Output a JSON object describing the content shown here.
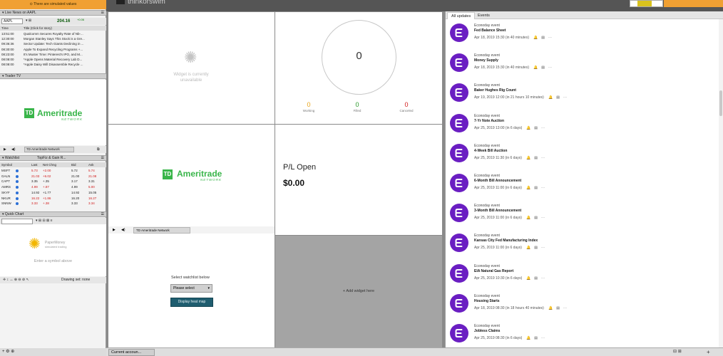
{
  "banner": {
    "text": "There are simulated values"
  },
  "live_news": {
    "header": "Live News on AAPL",
    "symbol": "AAPL",
    "price": "204.16",
    "change": "+0.06",
    "columns": {
      "time": "Time",
      "title": "Title (Click for story)"
    },
    "rows": [
      {
        "time": "13:51:00",
        "title": "Qualcomm Secures Royalty Rate of Nb-..."
      },
      {
        "time": "12:30:00",
        "title": "Morgan Stanley Says This Stock is a Gre..."
      },
      {
        "time": "09:36:36",
        "title": "Sector Update: Tech Giants Declining in ..."
      },
      {
        "time": "08:30:00",
        "title": "Apple To Expand Recycling Programs +..."
      },
      {
        "time": "08:23:00",
        "title": "It's Muster Time: Pinterest's IPO, and M..."
      },
      {
        "time": "08:08:00",
        "title": "*Apple Opens Material Recovery Lab D..."
      },
      {
        "time": "08:08:00",
        "title": "*Apple Daisy Will Disassemble Recycle ..."
      }
    ]
  },
  "trader_tv": {
    "header": "Trader TV",
    "logo_brand": "Ameritrade",
    "logo_sub": "NETWORK",
    "logo_mark": "TD",
    "tab_label": "TD Ameritrade Network"
  },
  "watchlist": {
    "header": "Watchlist",
    "tab": "TopFiz & Gain R...",
    "columns": [
      "Symbol",
      "Last",
      "Net Chng",
      "Bid",
      "Ask"
    ],
    "rows": [
      {
        "symbol": "MSFT",
        "last": "5.73",
        "net": "+2.00",
        "bid": "5.72",
        "ask": "5.74",
        "color": "#d11a1a"
      },
      {
        "symbol": "GALN",
        "last": "21.03",
        "net": "+6.02",
        "bid": "21.00",
        "ask": "21.08",
        "color": "#d11a1a"
      },
      {
        "symbol": "CAPT",
        "last": "3.35",
        "net": "+.35",
        "bid": "3.17",
        "ask": "3.31",
        "color": "#222222"
      },
      {
        "symbol": "AMRS",
        "last": "4.99",
        "net": "+.87",
        "bid": "4.99",
        "ask": "5.00",
        "color": "#d11a1a"
      },
      {
        "symbol": "SKYF",
        "last": "14.92",
        "net": "+1.77",
        "bid": "14.92",
        "ask": "15.05",
        "color": "#222222"
      },
      {
        "symbol": "NKUR",
        "last": "16.22",
        "net": "+1.86",
        "bid": "16.20",
        "ask": "16.27",
        "color": "#d11a1a"
      },
      {
        "symbol": "SNNW",
        "last": "3.33",
        "net": "+.38",
        "bid": "3.33",
        "ask": "3.34",
        "color": "#d11a1a"
      }
    ]
  },
  "quick_chart": {
    "header": "Quick Chart",
    "brand": "PaperMoney",
    "brand_sub": "simulated trading",
    "message": "Enter a symbol above",
    "drawing_label": "Drawing set: none"
  },
  "app": {
    "title": "thinkorswim",
    "bottom_tab": "Current accoun..."
  },
  "widget_unavailable": {
    "text": "Widget is currently unavailable"
  },
  "orders": {
    "count": "0",
    "working": {
      "value": "0",
      "label": "Working",
      "color": "#e8a317"
    },
    "filled": {
      "value": "0",
      "label": "Filled",
      "color": "#2c9a2c"
    },
    "canceled": {
      "value": "0",
      "label": "Canceled",
      "color": "#d11a1a"
    }
  },
  "ameritrade_widget": {
    "brand": "Ameritrade",
    "sub": "NETWORK",
    "mark": "TD"
  },
  "pl": {
    "label": "P/L Open",
    "value": "$0.00"
  },
  "tv2": {
    "tab_label": "TD Ameritrade Network"
  },
  "heatmap": {
    "label": "Select watchlist below",
    "select": "Please select",
    "button": "Display heat map"
  },
  "add_widget": {
    "label": "+ Add widget here"
  },
  "events_panel": {
    "tabs": [
      "All updates",
      "Events"
    ],
    "items": [
      {
        "type": "Econoday event",
        "name": "Fed Balance Sheet",
        "meta": "Apr 18, 2019 15:30 (in 40 minutes)"
      },
      {
        "type": "Econoday event",
        "name": "Money Supply",
        "meta": "Apr 18, 2019 15:30 (in 40 minutes)"
      },
      {
        "type": "Econoday event",
        "name": "Baker Hughes Rig Count",
        "meta": "Apr 19, 2019 12:00 (in 21 hours 10 minutes)"
      },
      {
        "type": "Econoday event",
        "name": "7-Yr Note Auction",
        "meta": "Apr 25, 2019 13:00 (in 6 days)"
      },
      {
        "type": "Econoday event",
        "name": "4-Week Bill Auction",
        "meta": "Apr 25, 2019 11:30 (in 6 days)"
      },
      {
        "type": "Econoday event",
        "name": "6-Month Bill Announcement",
        "meta": "Apr 25, 2019 11:00 (in 6 days)"
      },
      {
        "type": "Econoday event",
        "name": "3-Month Bill Announcement",
        "meta": "Apr 25, 2019 11:00 (in 6 days)"
      },
      {
        "type": "Econoday event",
        "name": "Kansas City Fed Manufacturing Index",
        "meta": "Apr 25, 2019 11:00 (in 6 days)"
      },
      {
        "type": "Econoday event",
        "name": "EIA Natural Gas Report",
        "meta": "Apr 25, 2019 10:30 (in 6 days)"
      },
      {
        "type": "Econoday event",
        "name": "Housing Starts",
        "meta": "Apr 18, 2019 08:30 (in 18 hours 40 minutes)"
      },
      {
        "type": "Econoday event",
        "name": "Jobless Claims",
        "meta": "Apr 25, 2019 08:30 (in 6 days)"
      }
    ]
  },
  "colors": {
    "accent": "#f0a033",
    "event_icon": "#6a1ec2",
    "ameritrade_green": "#39b54a"
  }
}
